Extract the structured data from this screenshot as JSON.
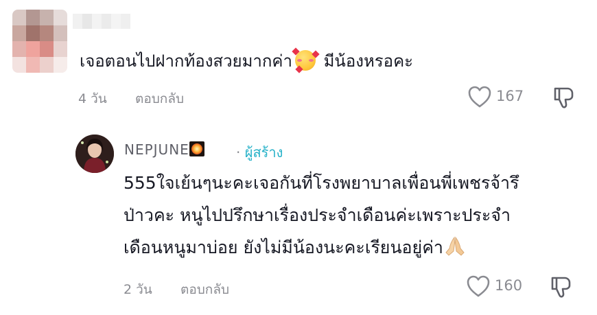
{
  "comment": {
    "author_avatar": "blurred-avatar",
    "author_name": "",
    "text_before_emoji": "เจอตอนไปฝากท้องสวยมากค่า",
    "emoji": "smiling-face-with-hearts",
    "text_after_emoji": " มีน้องหรอคะ",
    "time": "4 วัน",
    "reply_label": "ตอบกลับ",
    "like_count": "167"
  },
  "reply": {
    "author_name": "NEPJUNE",
    "author_badge": "fireworks-emoji",
    "separator": "·",
    "creator_tag": "ผู้สร้าง",
    "lines": [
      "555ใจเย้นๆนะคะเจอกันที่โรงพยาบาลเพื่อนพี่เพชรจ้ารึ",
      "ป่าวคะ หนูไปปรึกษาเรื่องประจำเดือนค่ะเพราะประจำ",
      "เดือนหนูมาบ่อย ยังไม่มีน้องนะคะเรียนอยู่ค่า"
    ],
    "emoji": "folded-hands",
    "time": "2 วัน",
    "reply_label": "ตอบกลับ",
    "like_count": "160"
  }
}
